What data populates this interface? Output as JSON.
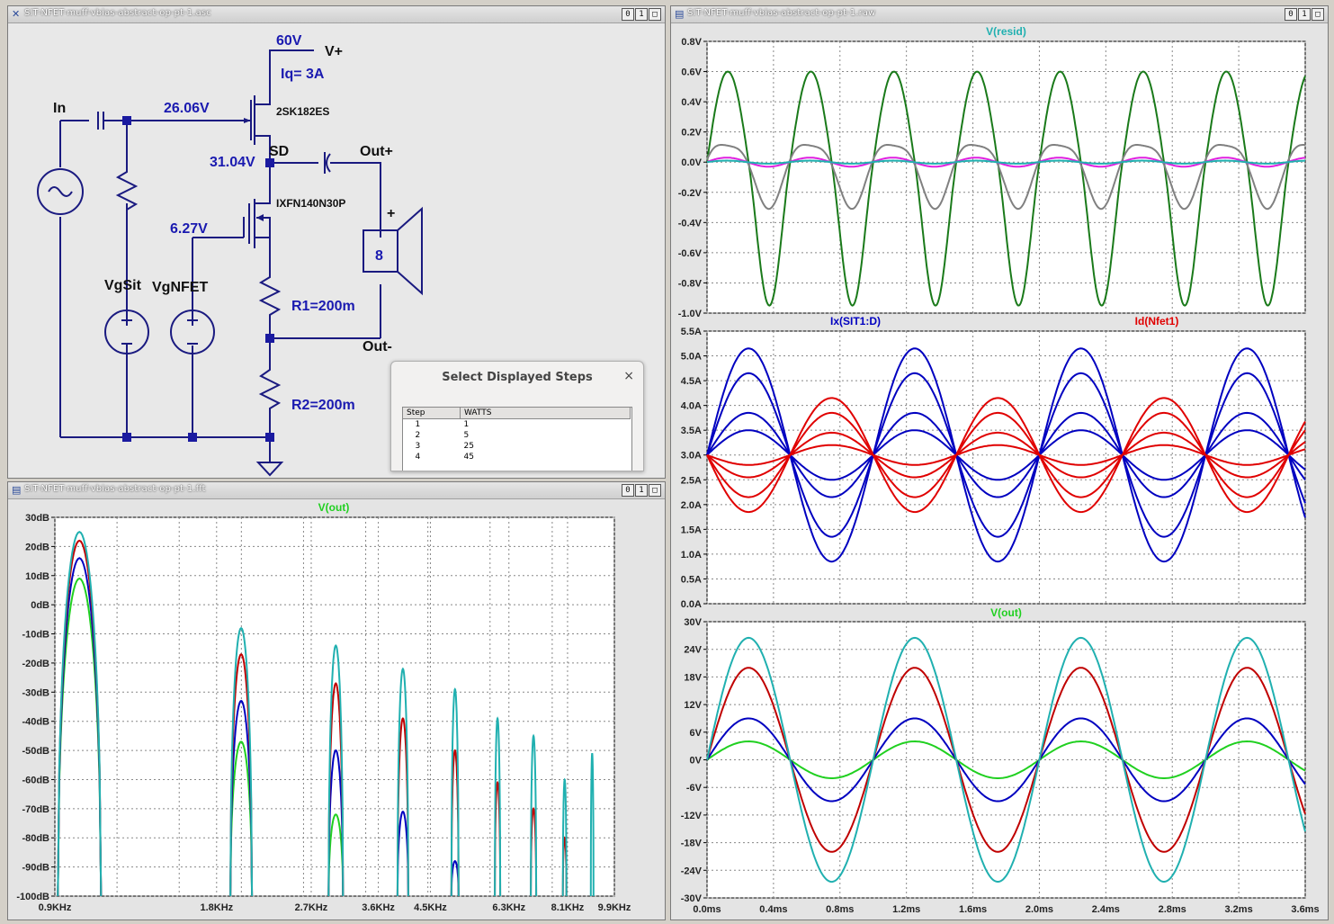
{
  "windows": {
    "schematic": {
      "title": "SIT-NFET-muff-vbias-abstract-op-pt-1.asc"
    },
    "waveform": {
      "title": "SIT-NFET-muff-vbias-abstract-op-pt-1.raw"
    },
    "fft": {
      "title": "SIT-NFET-muff-vbias-abstract-op-pt-1.fft"
    },
    "window_buttons": [
      "0",
      "1",
      "□"
    ]
  },
  "schematic": {
    "labels": {
      "vsupply": "60V",
      "vplus": "V+",
      "iq": "Iq=  3A",
      "in": "In",
      "gate_v": "26.06V",
      "sit_part": "2SK182ES",
      "sd_v": "31.04V",
      "sd": "SD",
      "out_plus": "Out+",
      "nfet_part": "IXFN140N30P",
      "nfet_gate_v": "6.27V",
      "speaker": "8",
      "speaker_plus": "+",
      "vgsit": "VgSit",
      "vgnfet": "VgNFET",
      "r1": "R1=200m",
      "out_minus": "Out-",
      "r2": "R2=200m"
    }
  },
  "dialog": {
    "title": "Select Displayed Steps",
    "close": "×",
    "columns": [
      "Step",
      "WATTS"
    ],
    "rows": [
      [
        "1",
        "1"
      ],
      [
        "2",
        "5"
      ],
      [
        "3",
        "25"
      ],
      [
        "4",
        "45"
      ]
    ]
  },
  "colors": {
    "green": "#00a000",
    "darkgreen": "#1a7a1a",
    "gray": "#808080",
    "magenta": "#e020e0",
    "cyan": "#20b0b0",
    "blue": "#0000c0",
    "red": "#e00000",
    "lime": "#20d020",
    "label_blue": "#1a1ab0"
  },
  "chart_data": [
    {
      "type": "line",
      "title": "V(resid)",
      "x_unit": "ms",
      "xlim": [
        0,
        3.6
      ],
      "yticks": [
        "0.8V",
        "0.6V",
        "0.4V",
        "0.2V",
        "0.0V",
        "-0.2V",
        "-0.4V",
        "-0.6V",
        "-0.8V",
        "-1.0V"
      ],
      "ylim": [
        -1.0,
        0.8
      ],
      "series": [
        {
          "color": "#1a7a1a",
          "amplitude": 0.57,
          "offset": -0.2,
          "frequency_khz": 2.0
        },
        {
          "color": "#808080",
          "amplitude": 0.21,
          "offset": -0.1,
          "frequency_khz": 2.0
        },
        {
          "color": "#e020e0",
          "amplitude": 0.03,
          "offset": 0.0,
          "frequency_khz": 2.0
        },
        {
          "color": "#20b0b0",
          "amplitude": 0.01,
          "offset": 0.0,
          "frequency_khz": 2.0
        }
      ]
    },
    {
      "type": "line",
      "series_titles": [
        "Ix(SIT1:D)",
        "Id(Nfet1)"
      ],
      "xlim": [
        0,
        3.6
      ],
      "yticks": [
        "5.5A",
        "5.0A",
        "4.5A",
        "4.0A",
        "3.5A",
        "3.0A",
        "2.5A",
        "2.0A",
        "1.5A",
        "1.0A",
        "0.5A",
        "0.0A"
      ],
      "ylim": [
        0,
        5.5
      ],
      "series": [
        {
          "group": "Ix(SIT1:D)",
          "color": "#0000c0",
          "amplitudes": [
            0.5,
            0.85,
            1.65,
            2.15
          ],
          "offset": 3.0,
          "peak_at_ms": 0.25
        },
        {
          "group": "Id(Nfet1)",
          "color": "#e00000",
          "amplitudes": [
            0.2,
            0.45,
            0.85,
            1.15
          ],
          "offset": 3.0,
          "peak_at_ms": 0.75
        }
      ]
    },
    {
      "type": "line",
      "title": "V(out)",
      "xlim": [
        0,
        3.6
      ],
      "xticks": [
        "0.0ms",
        "0.4ms",
        "0.8ms",
        "1.2ms",
        "1.6ms",
        "2.0ms",
        "2.4ms",
        "2.8ms",
        "3.2ms",
        "3.6ms"
      ],
      "yticks": [
        "30V",
        "24V",
        "18V",
        "12V",
        "6V",
        "0V",
        "-6V",
        "-12V",
        "-18V",
        "-24V",
        "-30V"
      ],
      "ylim": [
        -30,
        30
      ],
      "series": [
        {
          "step": "1",
          "color": "#20d020",
          "amplitude": 4.0
        },
        {
          "step": "2",
          "color": "#0000c0",
          "amplitude": 9.0
        },
        {
          "step": "3",
          "color": "#c00000",
          "amplitude": 20.0
        },
        {
          "step": "4",
          "color": "#20b0b0",
          "amplitude": 26.5
        }
      ]
    },
    {
      "type": "line",
      "title": "V(out)",
      "xscale": "log",
      "xticks": [
        "0.9KHz",
        "1.8KHz",
        "2.7KHz",
        "3.6KHz",
        "4.5KHz",
        "6.3KHz",
        "8.1KHz",
        "9.9KHz"
      ],
      "yticks": [
        "30dB",
        "20dB",
        "10dB",
        "0dB",
        "-10dB",
        "-20dB",
        "-30dB",
        "-40dB",
        "-50dB",
        "-60dB",
        "-70dB",
        "-80dB",
        "-90dB",
        "-100dB"
      ],
      "ylim": [
        -100,
        30
      ],
      "harmonics_khz": [
        1.0,
        2.0,
        3.0,
        4.0,
        5.0,
        6.0,
        7.0,
        8.0,
        9.0
      ],
      "series": [
        {
          "step": "1",
          "color": "#20d020",
          "peaks_db": [
            9,
            -47,
            -72
          ]
        },
        {
          "step": "2",
          "color": "#0000c0",
          "peaks_db": [
            16,
            -33,
            -50,
            -71,
            -88
          ]
        },
        {
          "step": "3",
          "color": "#c00000",
          "peaks_db": [
            22,
            -17,
            -27,
            -39,
            -50,
            -61,
            -70,
            -80
          ]
        },
        {
          "step": "4",
          "color": "#20b0b0",
          "peaks_db": [
            25,
            -8,
            -14,
            -22,
            -29,
            -39,
            -45,
            -60,
            -51
          ]
        }
      ]
    }
  ]
}
